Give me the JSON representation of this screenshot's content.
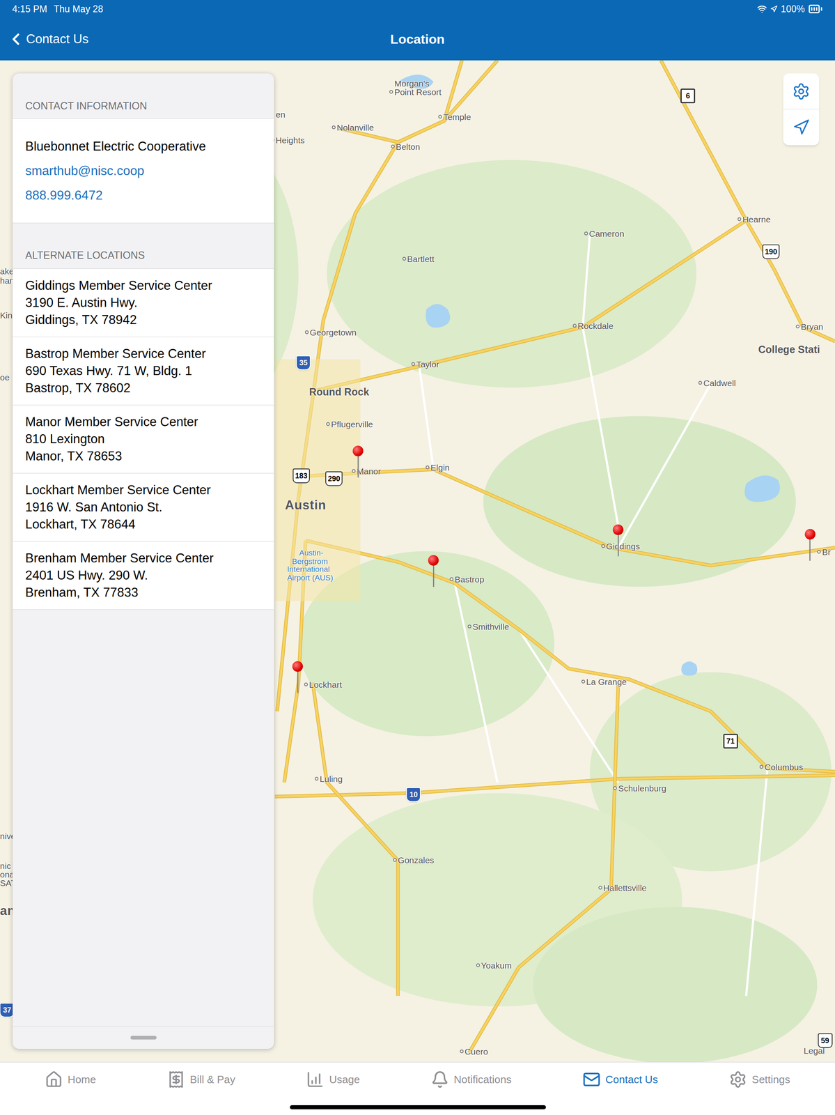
{
  "status_bar": {
    "time": "4:15 PM",
    "date": "Thu May 28",
    "battery": "100%"
  },
  "nav": {
    "back": "Contact Us",
    "title": "Location"
  },
  "contact": {
    "header": "CONTACT INFORMATION",
    "name": "Bluebonnet Electric Cooperative",
    "email": "smarthub@nisc.coop",
    "phone": "888.999.6472"
  },
  "alternate": {
    "header": "ALTERNATE LOCATIONS",
    "locations": [
      {
        "name": "Giddings Member Service Center",
        "street": "3190 E. Austin Hwy.",
        "city": "Giddings, TX 78942"
      },
      {
        "name": "Bastrop Member Service Center",
        "street": "690 Texas Hwy. 71 W, Bldg. 1",
        "city": "Bastrop, TX 78602"
      },
      {
        "name": "Manor Member Service Center",
        "street": "810 Lexington",
        "city": "Manor, TX 78653"
      },
      {
        "name": "Lockhart Member Service Center",
        "street": "1916 W. San Antonio St.",
        "city": "Lockhart, TX 78644"
      },
      {
        "name": "Brenham Member Service Center",
        "street": "2401 US Hwy. 290 W.",
        "city": "Brenham, TX 77833"
      }
    ]
  },
  "map": {
    "labels": [
      {
        "text": "Morgan's",
        "kind": "plain"
      },
      {
        "text": "Point Resort",
        "kind": "town"
      },
      {
        "text": "Temple",
        "kind": "town"
      },
      {
        "text": "Nolanville",
        "kind": "town"
      },
      {
        "text": "Belton",
        "kind": "town"
      },
      {
        "text": "en",
        "kind": "plain"
      },
      {
        "text": "Heights",
        "kind": "town"
      },
      {
        "text": "Cameron",
        "kind": "town"
      },
      {
        "text": "Hearne",
        "kind": "town"
      },
      {
        "text": "Bartlett",
        "kind": "town"
      },
      {
        "text": "Rockdale",
        "kind": "town"
      },
      {
        "text": "Bryan",
        "kind": "town"
      },
      {
        "text": "College Stati",
        "kind": "city"
      },
      {
        "text": "Georgetown",
        "kind": "town"
      },
      {
        "text": "Taylor",
        "kind": "town"
      },
      {
        "text": "Caldwell",
        "kind": "town"
      },
      {
        "text": "Round Rock",
        "kind": "city"
      },
      {
        "text": "Pflugerville",
        "kind": "town"
      },
      {
        "text": "Manor",
        "kind": "town"
      },
      {
        "text": "Elgin",
        "kind": "town"
      },
      {
        "text": "Austin",
        "kind": "metro"
      },
      {
        "text": "Austin-",
        "kind": "airport"
      },
      {
        "text": "Bergstrom",
        "kind": "airport"
      },
      {
        "text": "International",
        "kind": "airport"
      },
      {
        "text": "Airport (AUS)",
        "kind": "airport"
      },
      {
        "text": "Giddings",
        "kind": "town"
      },
      {
        "text": "Br",
        "kind": "town"
      },
      {
        "text": "Bastrop",
        "kind": "town"
      },
      {
        "text": "Smithville",
        "kind": "town"
      },
      {
        "text": "Lockhart",
        "kind": "town"
      },
      {
        "text": "La Grange",
        "kind": "town"
      },
      {
        "text": "Columbus",
        "kind": "town"
      },
      {
        "text": "Schulenburg",
        "kind": "town"
      },
      {
        "text": "Luling",
        "kind": "town"
      },
      {
        "text": "Gonzales",
        "kind": "town"
      },
      {
        "text": "Hallettsville",
        "kind": "town"
      },
      {
        "text": "Yoakum",
        "kind": "town"
      },
      {
        "text": "Cuero",
        "kind": "town"
      },
      {
        "text": "Legal",
        "kind": "plain"
      },
      {
        "text": "ake",
        "kind": "plain"
      },
      {
        "text": "han",
        "kind": "plain"
      },
      {
        "text": "Kin",
        "kind": "plain"
      },
      {
        "text": "oe",
        "kind": "plain"
      },
      {
        "text": "nive",
        "kind": "plain"
      },
      {
        "text": "nic",
        "kind": "plain"
      },
      {
        "text": "ona",
        "kind": "plain"
      },
      {
        "text": "SAT",
        "kind": "plain"
      },
      {
        "text": "an",
        "kind": "metro"
      }
    ],
    "shields": [
      {
        "text": "6",
        "kind": "state"
      },
      {
        "text": "35",
        "kind": "interstate"
      },
      {
        "text": "183",
        "kind": "us"
      },
      {
        "text": "290",
        "kind": "us"
      },
      {
        "text": "190",
        "kind": "us"
      },
      {
        "text": "10",
        "kind": "interstate"
      },
      {
        "text": "71",
        "kind": "state"
      },
      {
        "text": "59",
        "kind": "us"
      },
      {
        "text": "37",
        "kind": "interstate"
      }
    ]
  },
  "tabs": [
    {
      "label": "Home",
      "selected": false
    },
    {
      "label": "Bill & Pay",
      "selected": false
    },
    {
      "label": "Usage",
      "selected": false
    },
    {
      "label": "Notifications",
      "selected": false
    },
    {
      "label": "Contact Us",
      "selected": true
    },
    {
      "label": "Settings",
      "selected": false
    }
  ]
}
